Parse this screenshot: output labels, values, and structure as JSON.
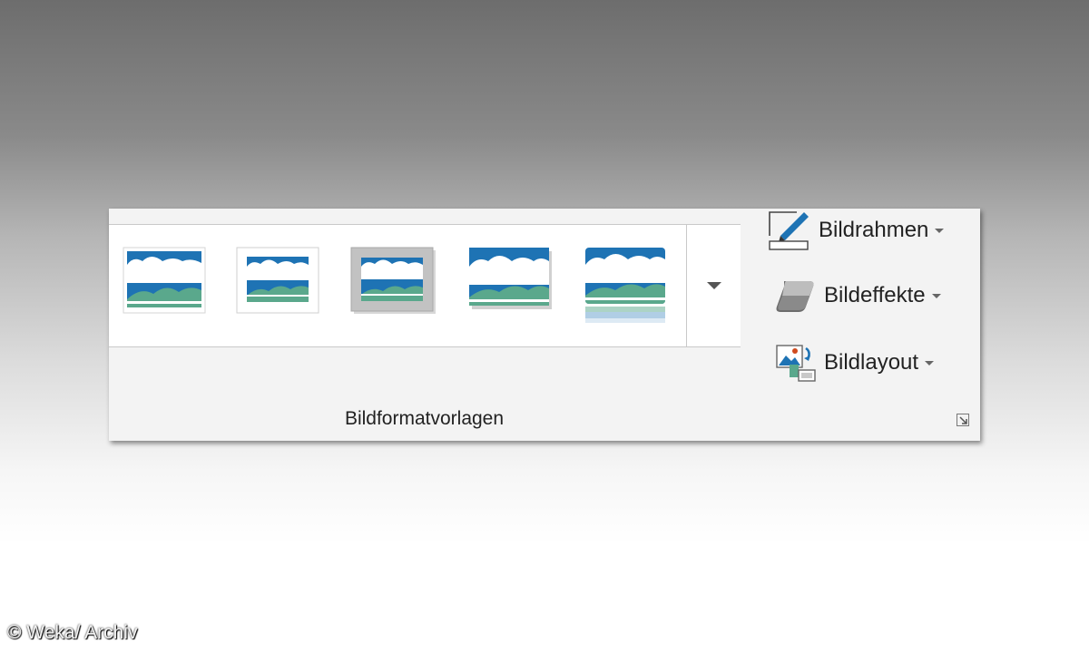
{
  "ribbon": {
    "group_label": "Bildformatvorlagen",
    "gallery": {
      "styles": [
        {
          "name": "Einfacher Rahmen, weiß"
        },
        {
          "name": "Weißer Rahmen"
        },
        {
          "name": "Grauer Rahmen"
        },
        {
          "name": "Schatten"
        },
        {
          "name": "Spiegelung"
        }
      ]
    },
    "commands": {
      "frame_label": "Bildrahmen",
      "effects_label": "Bildeffekte",
      "layout_label": "Bildlayout"
    }
  },
  "watermark": {
    "text": "© Weka/ Archiv"
  },
  "colors": {
    "sky_blue": "#1e73b4",
    "hill_green": "#5aa88c",
    "selected_frame": "#c2c2c2"
  },
  "icons": [
    "pencil-frame-icon",
    "eraser-icon",
    "picture-layout-icon",
    "chevron-down-icon",
    "dialog-launcher-icon"
  ]
}
